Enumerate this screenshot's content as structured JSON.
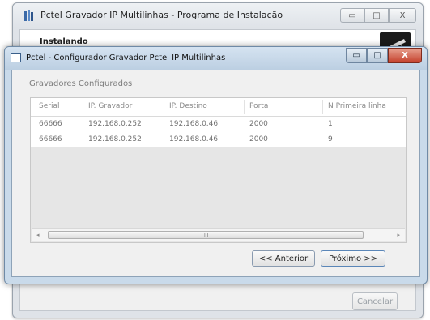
{
  "background_window": {
    "title": "Pctel Gravador IP Multilinhas - Programa de Instalação",
    "header_text": "Instalando",
    "cancel_label": "Cancelar",
    "controls": {
      "minimize": "▭",
      "maximize": "□",
      "close": "X"
    }
  },
  "dialog": {
    "title": "Pctel - Configurador Gravador Pctel IP Multilinhas",
    "controls": {
      "minimize": "▭",
      "maximize": "□",
      "close": "X"
    },
    "section_label": "Gravadores Configurados",
    "table": {
      "columns": [
        "Serial",
        "IP. Gravador",
        "IP. Destino",
        "Porta",
        "N Primeira linha"
      ],
      "rows": [
        [
          "66666",
          "192.168.0.252",
          "192.168.0.46",
          "2000",
          "1"
        ],
        [
          "66666",
          "192.168.0.252",
          "192.168.0.46",
          "2000",
          "9"
        ]
      ]
    },
    "scrollbar": {
      "left_arrow": "◂",
      "right_arrow": "▸",
      "grip": "III"
    },
    "buttons": {
      "previous": "<< Anterior",
      "next": "Próximo >>"
    }
  },
  "colors": {
    "dialog_frame": "#c9daea",
    "close_button": "#c4412c",
    "panel_background": "#f0f0f0"
  }
}
